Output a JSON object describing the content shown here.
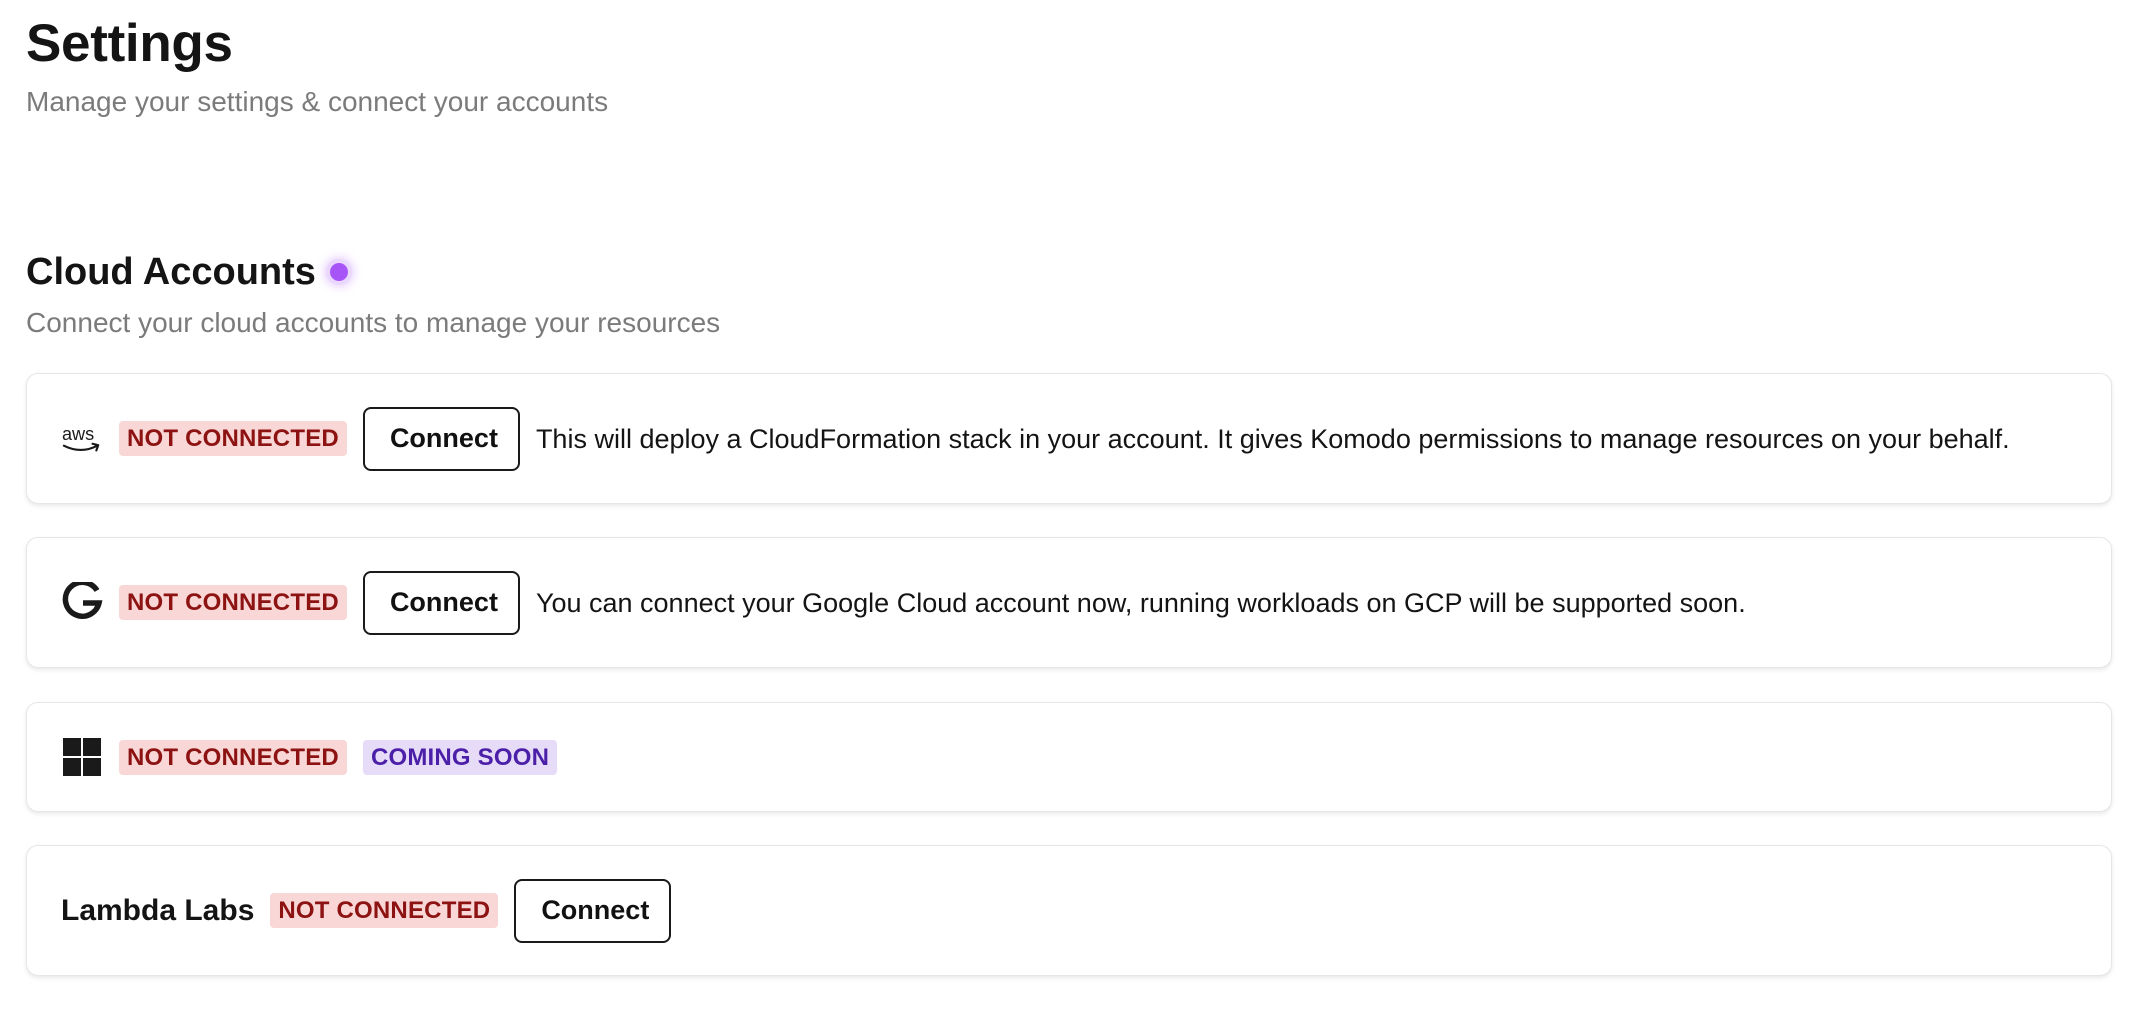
{
  "header": {
    "title": "Settings",
    "subtitle": "Manage your settings & connect your accounts"
  },
  "cloud_accounts": {
    "title": "Cloud Accounts",
    "subtitle": "Connect your cloud accounts to manage your resources",
    "accent_color": "#a855f7",
    "accounts": [
      {
        "provider": "aws",
        "icon": "aws-logo-icon",
        "status": "NOT CONNECTED",
        "connect_label": "Connect",
        "description": "This will deploy a CloudFormation stack in your account. It gives Komodo permissions to manage resources on your behalf."
      },
      {
        "provider": "gcp",
        "icon": "google-logo-icon",
        "status": "NOT CONNECTED",
        "connect_label": "Connect",
        "description": "You can connect your Google Cloud account now, running workloads on GCP will be supported soon."
      },
      {
        "provider": "azure",
        "icon": "windows-logo-icon",
        "status": "NOT CONNECTED",
        "coming_soon": "COMING SOON"
      },
      {
        "provider": "lambda",
        "name": "Lambda Labs",
        "status": "NOT CONNECTED",
        "connect_label": "Connect"
      }
    ]
  },
  "colors": {
    "not_connected_bg": "#f8d7d6",
    "not_connected_text": "#8d1313",
    "coming_soon_bg": "#e6dcf8",
    "coming_soon_text": "#4b1fa8"
  }
}
